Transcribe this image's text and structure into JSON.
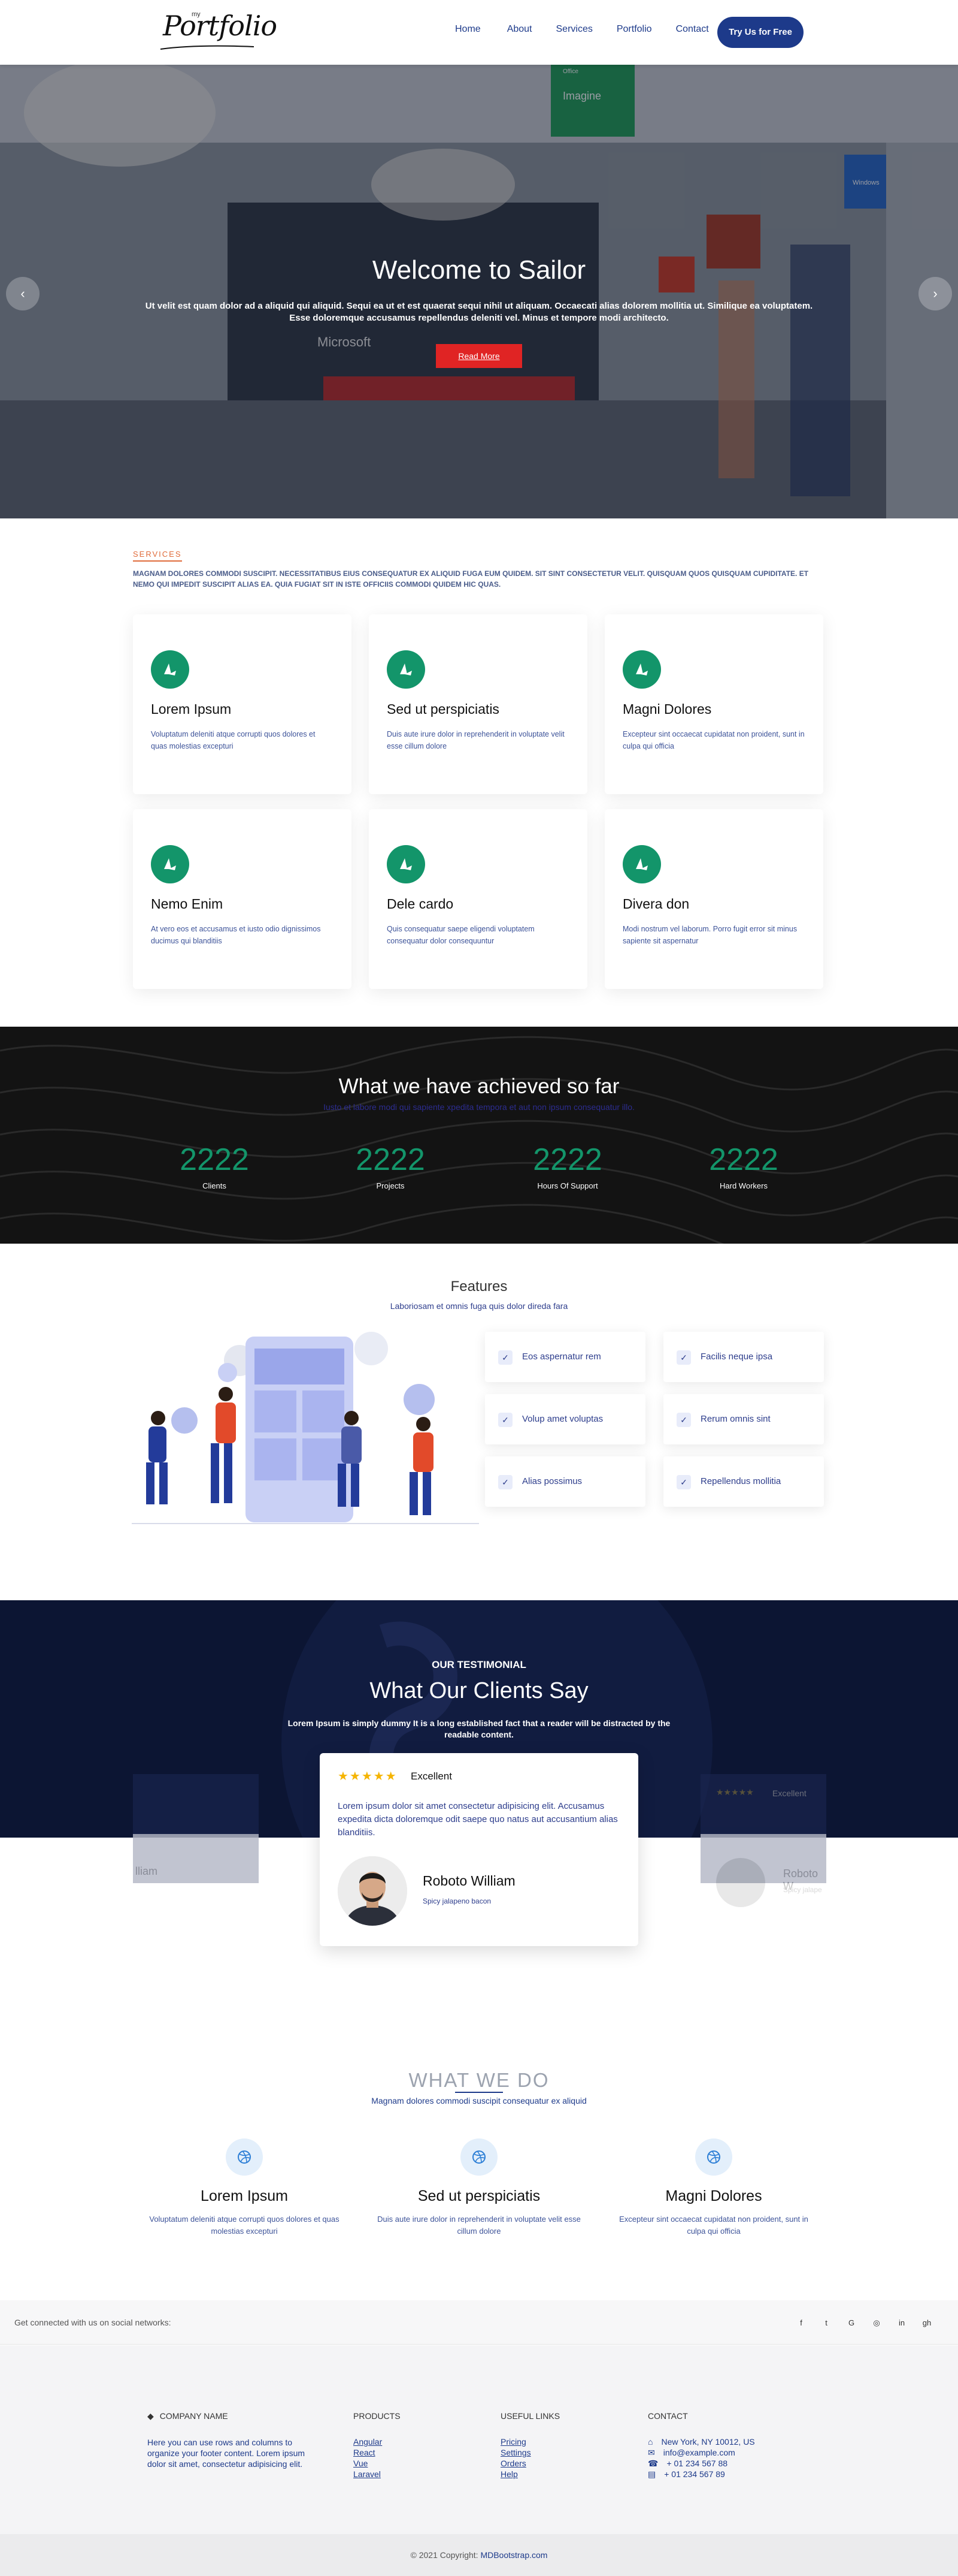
{
  "nav": {
    "logo_small": "my",
    "logo": "Portfolio",
    "items": [
      "Home",
      "About",
      "Services",
      "Portfolio",
      "Contact"
    ],
    "cta": "Try Us for Free"
  },
  "hero": {
    "title": "Welcome to Sailor",
    "text": "Ut velit est quam dolor ad a aliquid qui aliquid. Sequi ea ut et est quaerat sequi nihil ut aliquam. Occaecati alias dolorem mollitia ut. Similique ea voluptatem. Esse doloremque accusamus repellendus deleniti vel. Minus et tempore modi architecto.",
    "button": "Read More",
    "prev": "‹",
    "next": "›",
    "scene_text": {
      "brand": "Microsoft",
      "sign_office": "Office",
      "sign_imagine": "Imagine",
      "sign_windows": "Windows"
    }
  },
  "services": {
    "label": "SERVICES",
    "description": "MAGNAM DOLORES COMMODI SUSCIPIT. NECESSITATIBUS EIUS CONSEQUATUR EX ALIQUID FUGA EUM QUIDEM. SIT SINT CONSECTETUR VELIT. QUISQUAM QUOS QUISQUAM CUPIDITATE. ET NEMO QUI IMPEDIT SUSCIPIT ALIAS EA. QUIA FUGIAT SIT IN ISTE OFFICIIS COMMODI QUIDEM HIC QUAS.",
    "cards": [
      {
        "title": "Lorem Ipsum",
        "text": "Voluptatum deleniti atque corrupti quos dolores et quas molestias excepturi"
      },
      {
        "title": "Sed ut perspiciatis",
        "text": "Duis aute irure dolor in reprehenderit in voluptate velit esse cillum dolore"
      },
      {
        "title": "Magni Dolores",
        "text": "Excepteur sint occaecat cupidatat non proident, sunt in culpa qui officia"
      },
      {
        "title": "Nemo Enim",
        "text": "At vero eos et accusamus et iusto odio dignissimos ducimus qui blanditiis"
      },
      {
        "title": "Dele cardo",
        "text": "Quis consequatur saepe eligendi voluptatem consequatur dolor consequuntur"
      },
      {
        "title": "Divera don",
        "text": "Modi nostrum vel laborum. Porro fugit error sit minus sapiente sit aspernatur"
      }
    ]
  },
  "stats": {
    "title": "What we have achieved so far",
    "subtitle": "Iusto et labore modi qui sapiente xpedita tempora et aut non ipsum consequatur illo.",
    "items": [
      {
        "value": "2222",
        "label": "Clients"
      },
      {
        "value": "2222",
        "label": "Projects"
      },
      {
        "value": "2222",
        "label": "Hours Of Support"
      },
      {
        "value": "2222",
        "label": "Hard Workers"
      }
    ]
  },
  "features": {
    "title": "Features",
    "subtitle": "Laboriosam et omnis fuga quis dolor direda fara",
    "items": [
      "Eos aspernatur rem",
      "Facilis neque ipsa",
      "Volup amet voluptas",
      "Rerum omnis sint",
      "Alias possimus",
      "Repellendus mollitia"
    ]
  },
  "testimonial": {
    "label": "OUR TESTIMONIAL",
    "title": "What Our Clients Say",
    "text": "Lorem Ipsum is simply dummy It is a long established fact that a reader will be distracted by the readable content.",
    "stars": "★★★★★",
    "rating": "Excellent",
    "quote": "Lorem ipsum dolor sit amet consectetur adipisicing elit. Accusamus expedita dicta doloremque odit saepe quo natus aut accusantium alias blanditiis.",
    "name": "Roboto William",
    "role": "Spicy jalapeno bacon",
    "ghost_left_name": "lliam",
    "ghost_right_name": "Roboto W",
    "ghost_right_role": "Spicy jalape"
  },
  "whatwedo": {
    "title": "WHAT WE DO",
    "subtitle": "Magnam dolores commodi suscipit consequatur ex aliquid",
    "items": [
      {
        "title": "Lorem Ipsum",
        "text": "Voluptatum deleniti atque corrupti quos dolores et quas molestias excepturi"
      },
      {
        "title": "Sed ut perspiciatis",
        "text": "Duis aute irure dolor in reprehenderit in voluptate velit esse cillum dolore"
      },
      {
        "title": "Magni Dolores",
        "text": "Excepteur sint occaecat cupidatat non proident, sunt in culpa qui officia"
      }
    ]
  },
  "footer": {
    "social_text": "Get connected with us on social networks:",
    "social_icons": [
      "f",
      "t",
      "G",
      "◎",
      "in",
      "gh"
    ],
    "company_title": "COMPANY NAME",
    "company_text": "Here you can use rows and columns to organize your footer content. Lorem ipsum dolor sit amet, consectetur adipisicing elit.",
    "products_title": "PRODUCTS",
    "products": [
      "Angular",
      "React",
      "Vue",
      "Laravel"
    ],
    "links_title": "USEFUL LINKS",
    "links": [
      "Pricing",
      "Settings",
      "Orders",
      "Help"
    ],
    "contact_title": "CONTACT",
    "contact": [
      "New York, NY 10012, US",
      "info@example.com",
      "+ 01 234 567 88",
      "+ 01 234 567 89"
    ],
    "copyright": "© 2021 Copyright:",
    "copyright_link": "MDBootstrap.com"
  },
  "colors": {
    "accent": "#1d3a8a",
    "green": "#13956a",
    "red": "#e02424",
    "dark": "#131313",
    "navy": "#0c1533"
  }
}
